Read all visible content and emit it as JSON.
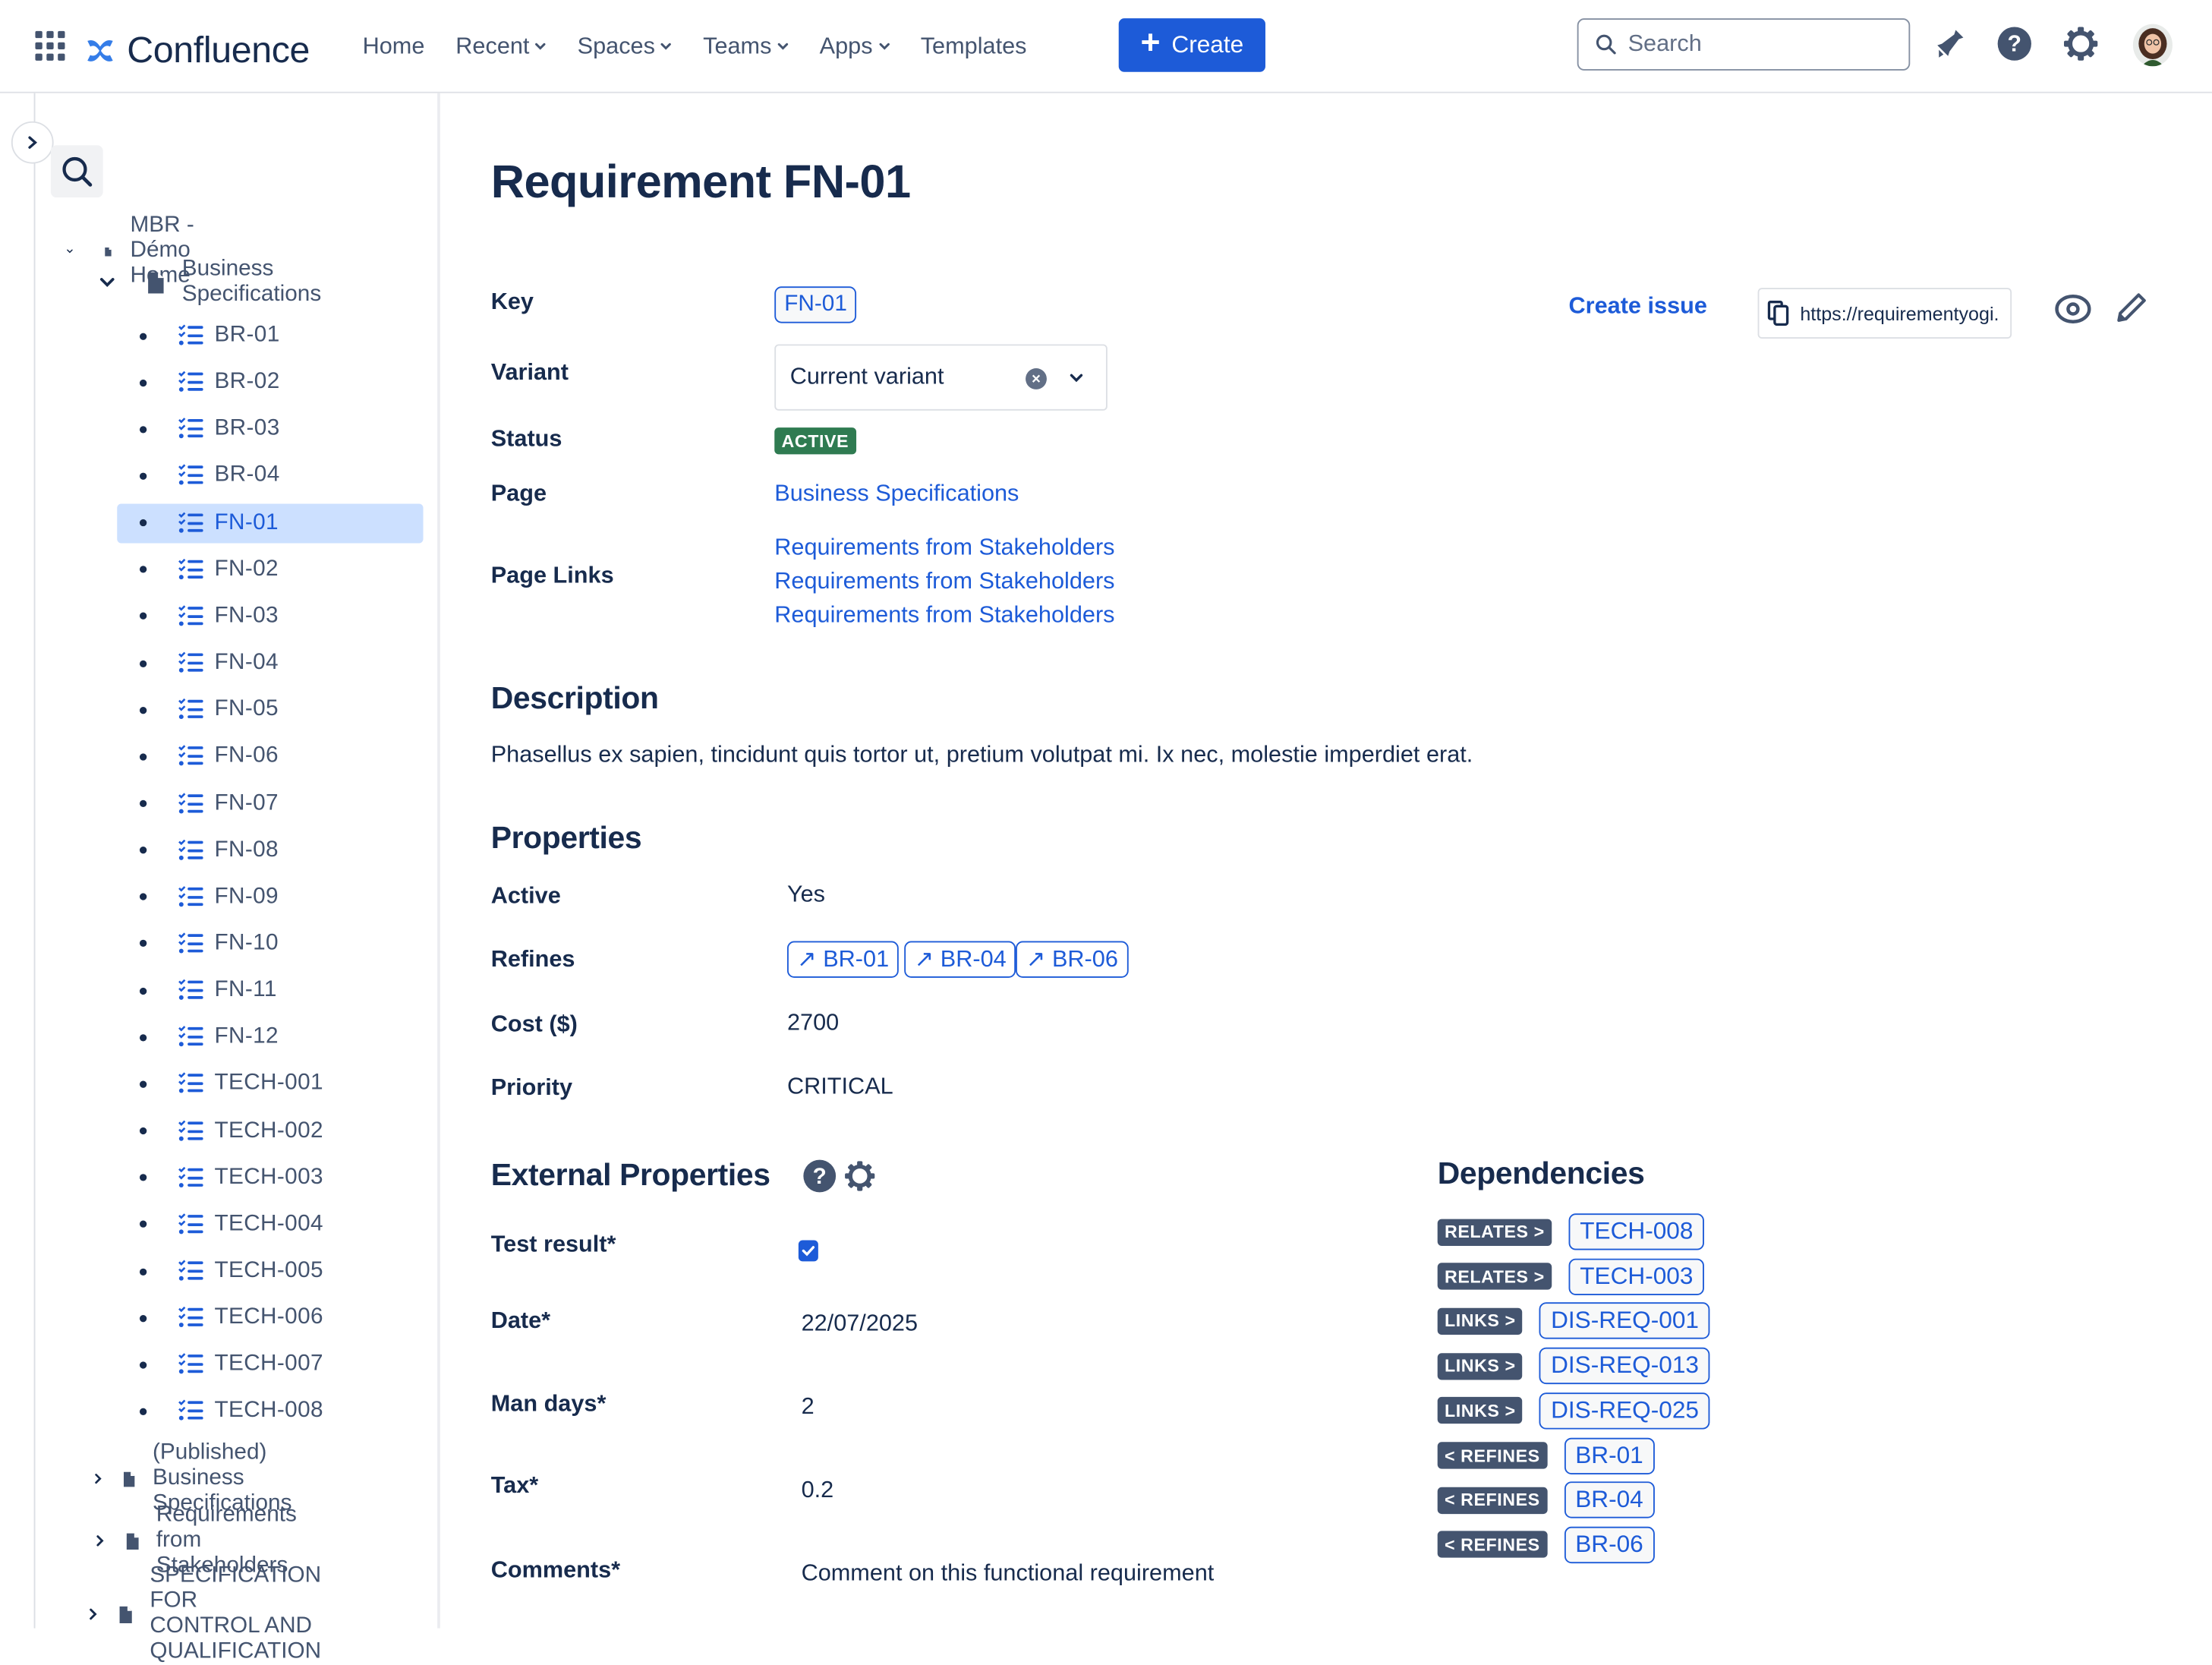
{
  "header": {
    "app_name": "Confluence",
    "nav": [
      {
        "label": "Home",
        "dropdown": false
      },
      {
        "label": "Recent",
        "dropdown": true
      },
      {
        "label": "Spaces",
        "dropdown": true
      },
      {
        "label": "Teams",
        "dropdown": true
      },
      {
        "label": "Apps",
        "dropdown": true
      },
      {
        "label": "Templates",
        "dropdown": false
      }
    ],
    "create_label": "Create",
    "search_placeholder": "Search",
    "icons": [
      "app-switcher-icon",
      "notifications-icon",
      "help-icon",
      "settings-icon",
      "avatar"
    ]
  },
  "sidebar": {
    "root": {
      "label": "MBR - Démo Home",
      "expanded": true
    },
    "business_specs": {
      "label_line1": "Business",
      "label_line2": "Specifications",
      "expanded": true
    },
    "requirements": [
      "BR-01",
      "BR-02",
      "BR-03",
      "BR-04",
      "FN-01",
      "FN-02",
      "FN-03",
      "FN-04",
      "FN-05",
      "FN-06",
      "FN-07",
      "FN-08",
      "FN-09",
      "FN-10",
      "FN-11",
      "FN-12",
      "TECH-001",
      "TECH-002",
      "TECH-003",
      "TECH-004",
      "TECH-005",
      "TECH-006",
      "TECH-007",
      "TECH-008"
    ],
    "selected": "FN-01",
    "other_pages": [
      {
        "line1": "(Published) Business",
        "line2": "Specifications",
        "line3": ""
      },
      {
        "line1": "Requirements from",
        "line2": "Stakeholders",
        "line3": ""
      },
      {
        "line1": "SPECIFICATION FOR",
        "line2": "CONTROL AND",
        "line3": "QUALIFICATION"
      }
    ]
  },
  "page": {
    "title": "Requirement FN-01",
    "fields": {
      "key_label": "Key",
      "key_value": "FN-01",
      "variant_label": "Variant",
      "variant_value": "Current variant",
      "status_label": "Status",
      "status_value": "ACTIVE",
      "page_label": "Page",
      "page_value": "Business Specifications",
      "page_links_label": "Page Links",
      "page_links": [
        "Requirements from Stakeholders",
        "Requirements from Stakeholders",
        "Requirements from Stakeholders"
      ]
    },
    "actions": {
      "create_issue": "Create issue",
      "url": "https://requirementyogi."
    },
    "description": {
      "heading": "Description",
      "text": "Phasellus ex sapien, tincidunt quis tortor ut, pretium volutpat mi. Ix nec, molestie imperdiet erat."
    },
    "properties": {
      "heading": "Properties",
      "active_label": "Active",
      "active_value": "Yes",
      "refines_label": "Refines",
      "refines": [
        "↗ BR-01",
        "↗ BR-04",
        "↗ BR-06"
      ],
      "cost_label": "Cost ($)",
      "cost_value": "2700",
      "priority_label": "Priority",
      "priority_value": "CRITICAL"
    },
    "external": {
      "heading": "External Properties",
      "test_label": "Test result*",
      "test_checked": true,
      "date_label": "Date*",
      "date_value": "22/07/2025",
      "mandays_label": "Man days*",
      "mandays_value": "2",
      "tax_label": "Tax*",
      "tax_value": "0.2",
      "comments_label": "Comments*",
      "comments_value": "Comment on this functional requirement"
    },
    "dependencies": {
      "heading": "Dependencies",
      "items": [
        {
          "type": "RELATES >",
          "key": "TECH-008"
        },
        {
          "type": "RELATES >",
          "key": "TECH-003"
        },
        {
          "type": "LINKS >",
          "key": "DIS-REQ-001"
        },
        {
          "type": "LINKS >",
          "key": "DIS-REQ-013"
        },
        {
          "type": "LINKS >",
          "key": "DIS-REQ-025"
        },
        {
          "type": "< REFINES",
          "key": "BR-01"
        },
        {
          "type": "< REFINES",
          "key": "BR-04"
        },
        {
          "type": "< REFINES",
          "key": "BR-06"
        }
      ]
    }
  },
  "colors": {
    "accent": "#1d5bd8",
    "status_active": "#2f7b51",
    "text": "#172b4d",
    "chip": "#44546f",
    "selected_bg": "#cce0ff"
  }
}
